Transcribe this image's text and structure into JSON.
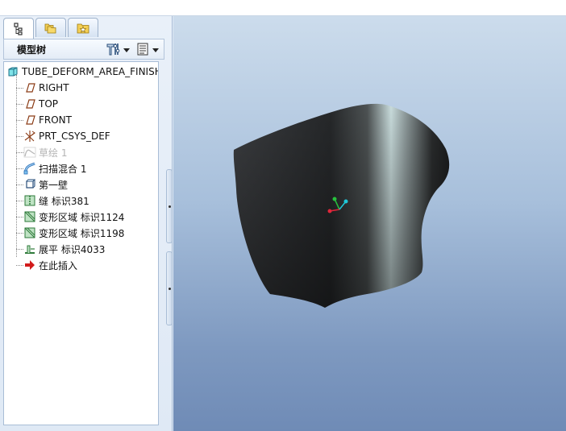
{
  "tabs": [
    {
      "name": "model-tree-tab",
      "icon": "model-tree-icon",
      "active": true
    },
    {
      "name": "folder-browser-tab",
      "icon": "folders-icon",
      "active": false
    },
    {
      "name": "favorites-tab",
      "icon": "favorites-icon",
      "active": false
    }
  ],
  "model_tree": {
    "title": "模型树",
    "settings_icon": "tree-settings-icon",
    "show_icon": "tree-show-icon",
    "root": "TUBE_DEFORM_AREA_FINISH",
    "items": [
      {
        "label": "RIGHT",
        "icon": "datum-plane-icon",
        "disabled": false
      },
      {
        "label": "TOP",
        "icon": "datum-plane-icon",
        "disabled": false
      },
      {
        "label": "FRONT",
        "icon": "datum-plane-icon",
        "disabled": false
      },
      {
        "label": "PRT_CSYS_DEF",
        "icon": "coordinate-system-icon",
        "disabled": false
      },
      {
        "label": "草绘 1",
        "icon": "sketch-icon",
        "disabled": true
      },
      {
        "label": "扫描混合 1",
        "icon": "swept-blend-icon",
        "disabled": false
      },
      {
        "label": "第一壁",
        "icon": "first-wall-icon",
        "disabled": false
      },
      {
        "label": "缝 标识381",
        "icon": "rip-icon",
        "disabled": false
      },
      {
        "label": "变形区域 标识1124",
        "icon": "deform-area-icon",
        "disabled": false
      },
      {
        "label": "变形区域 标识1198",
        "icon": "deform-area-icon",
        "disabled": false
      },
      {
        "label": "展平 标识4033",
        "icon": "flatten-icon",
        "disabled": false
      },
      {
        "label": "在此插入",
        "icon": "insert-here-arrow-icon",
        "disabled": false
      }
    ]
  },
  "colors": {
    "panel_bg": "#dfe9f5",
    "viewport_top": "#ccdcec",
    "viewport_bottom": "#6f8bb6",
    "insert_arrow": "#d21b1b",
    "csys_x": "#e0263a",
    "csys_y": "#27c23d",
    "csys_z": "#1fc8d8"
  }
}
